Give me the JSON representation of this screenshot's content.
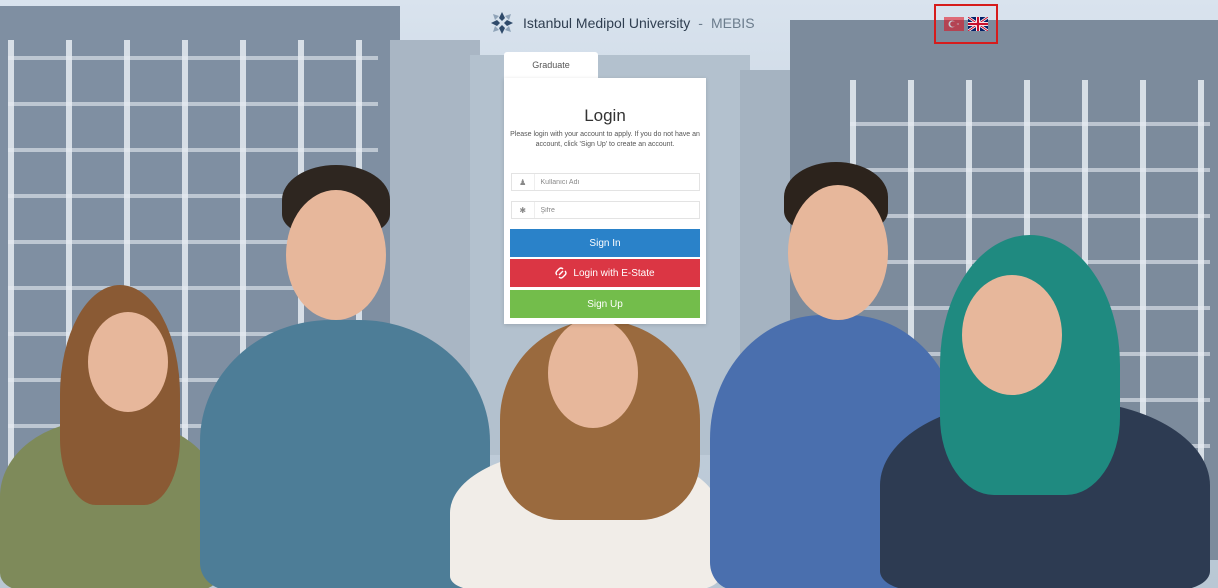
{
  "header": {
    "brand_name": "Istanbul Medipol University",
    "brand_separator": "-",
    "system_name": "MEBIS",
    "languages": [
      "tr",
      "en"
    ]
  },
  "tabs": [
    {
      "label": "Graduate"
    }
  ],
  "login": {
    "title": "Login",
    "description": "Please login with your account to apply. If you do not have an account, click 'Sign Up' to create an account.",
    "username_placeholder": "Kullanıcı Adı",
    "password_placeholder": "Şifre",
    "signin_label": "Sign In",
    "estate_label": "Login with E-State",
    "signup_label": "Sign Up"
  },
  "colors": {
    "signin": "#2a82c9",
    "estate": "#db3644",
    "signup": "#73bd4b",
    "highlight": "#d61c1c"
  }
}
